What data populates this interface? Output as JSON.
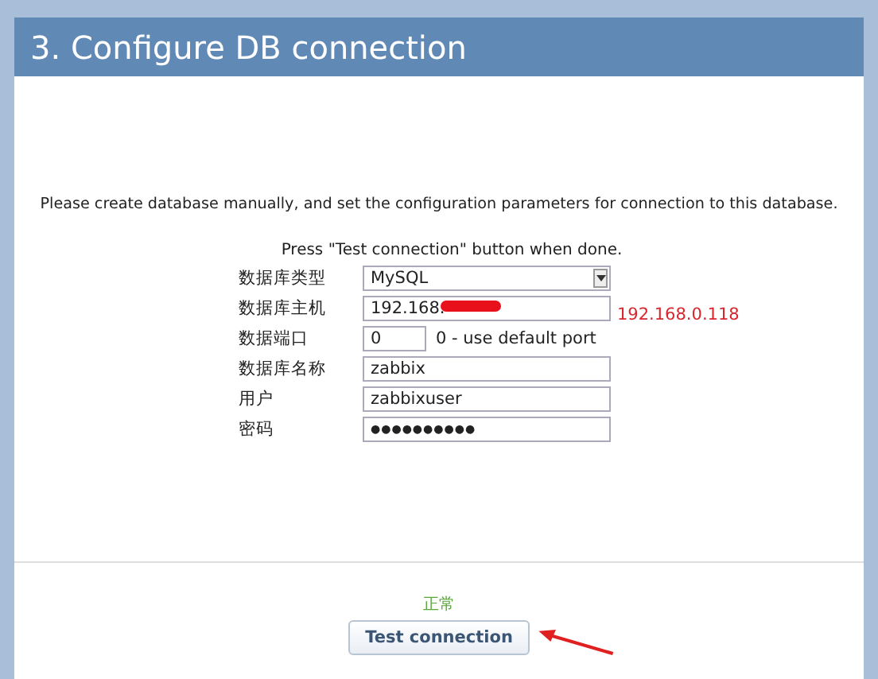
{
  "title": "3. Configure DB connection",
  "intro": "Please create database manually, and set the configuration parameters for connection to this database.",
  "hint": "Press \"Test connection\" button when done.",
  "fields": [
    {
      "kind": "select",
      "label": "数据库类型",
      "value": "MySQL"
    },
    {
      "kind": "text",
      "label": "数据库主机",
      "value": "192.168.",
      "redacted": true,
      "annotation": "192.168.0.118"
    },
    {
      "kind": "short",
      "label": "数据端口",
      "value": "0",
      "note": "0 - use default port"
    },
    {
      "kind": "text",
      "label": "数据库名称",
      "value": "zabbix"
    },
    {
      "kind": "text",
      "label": "用户",
      "value": "zabbixuser"
    },
    {
      "kind": "password",
      "label": "密码",
      "value": "●●●●●●●●●●"
    }
  ],
  "status": "正常",
  "button": "Test connection"
}
